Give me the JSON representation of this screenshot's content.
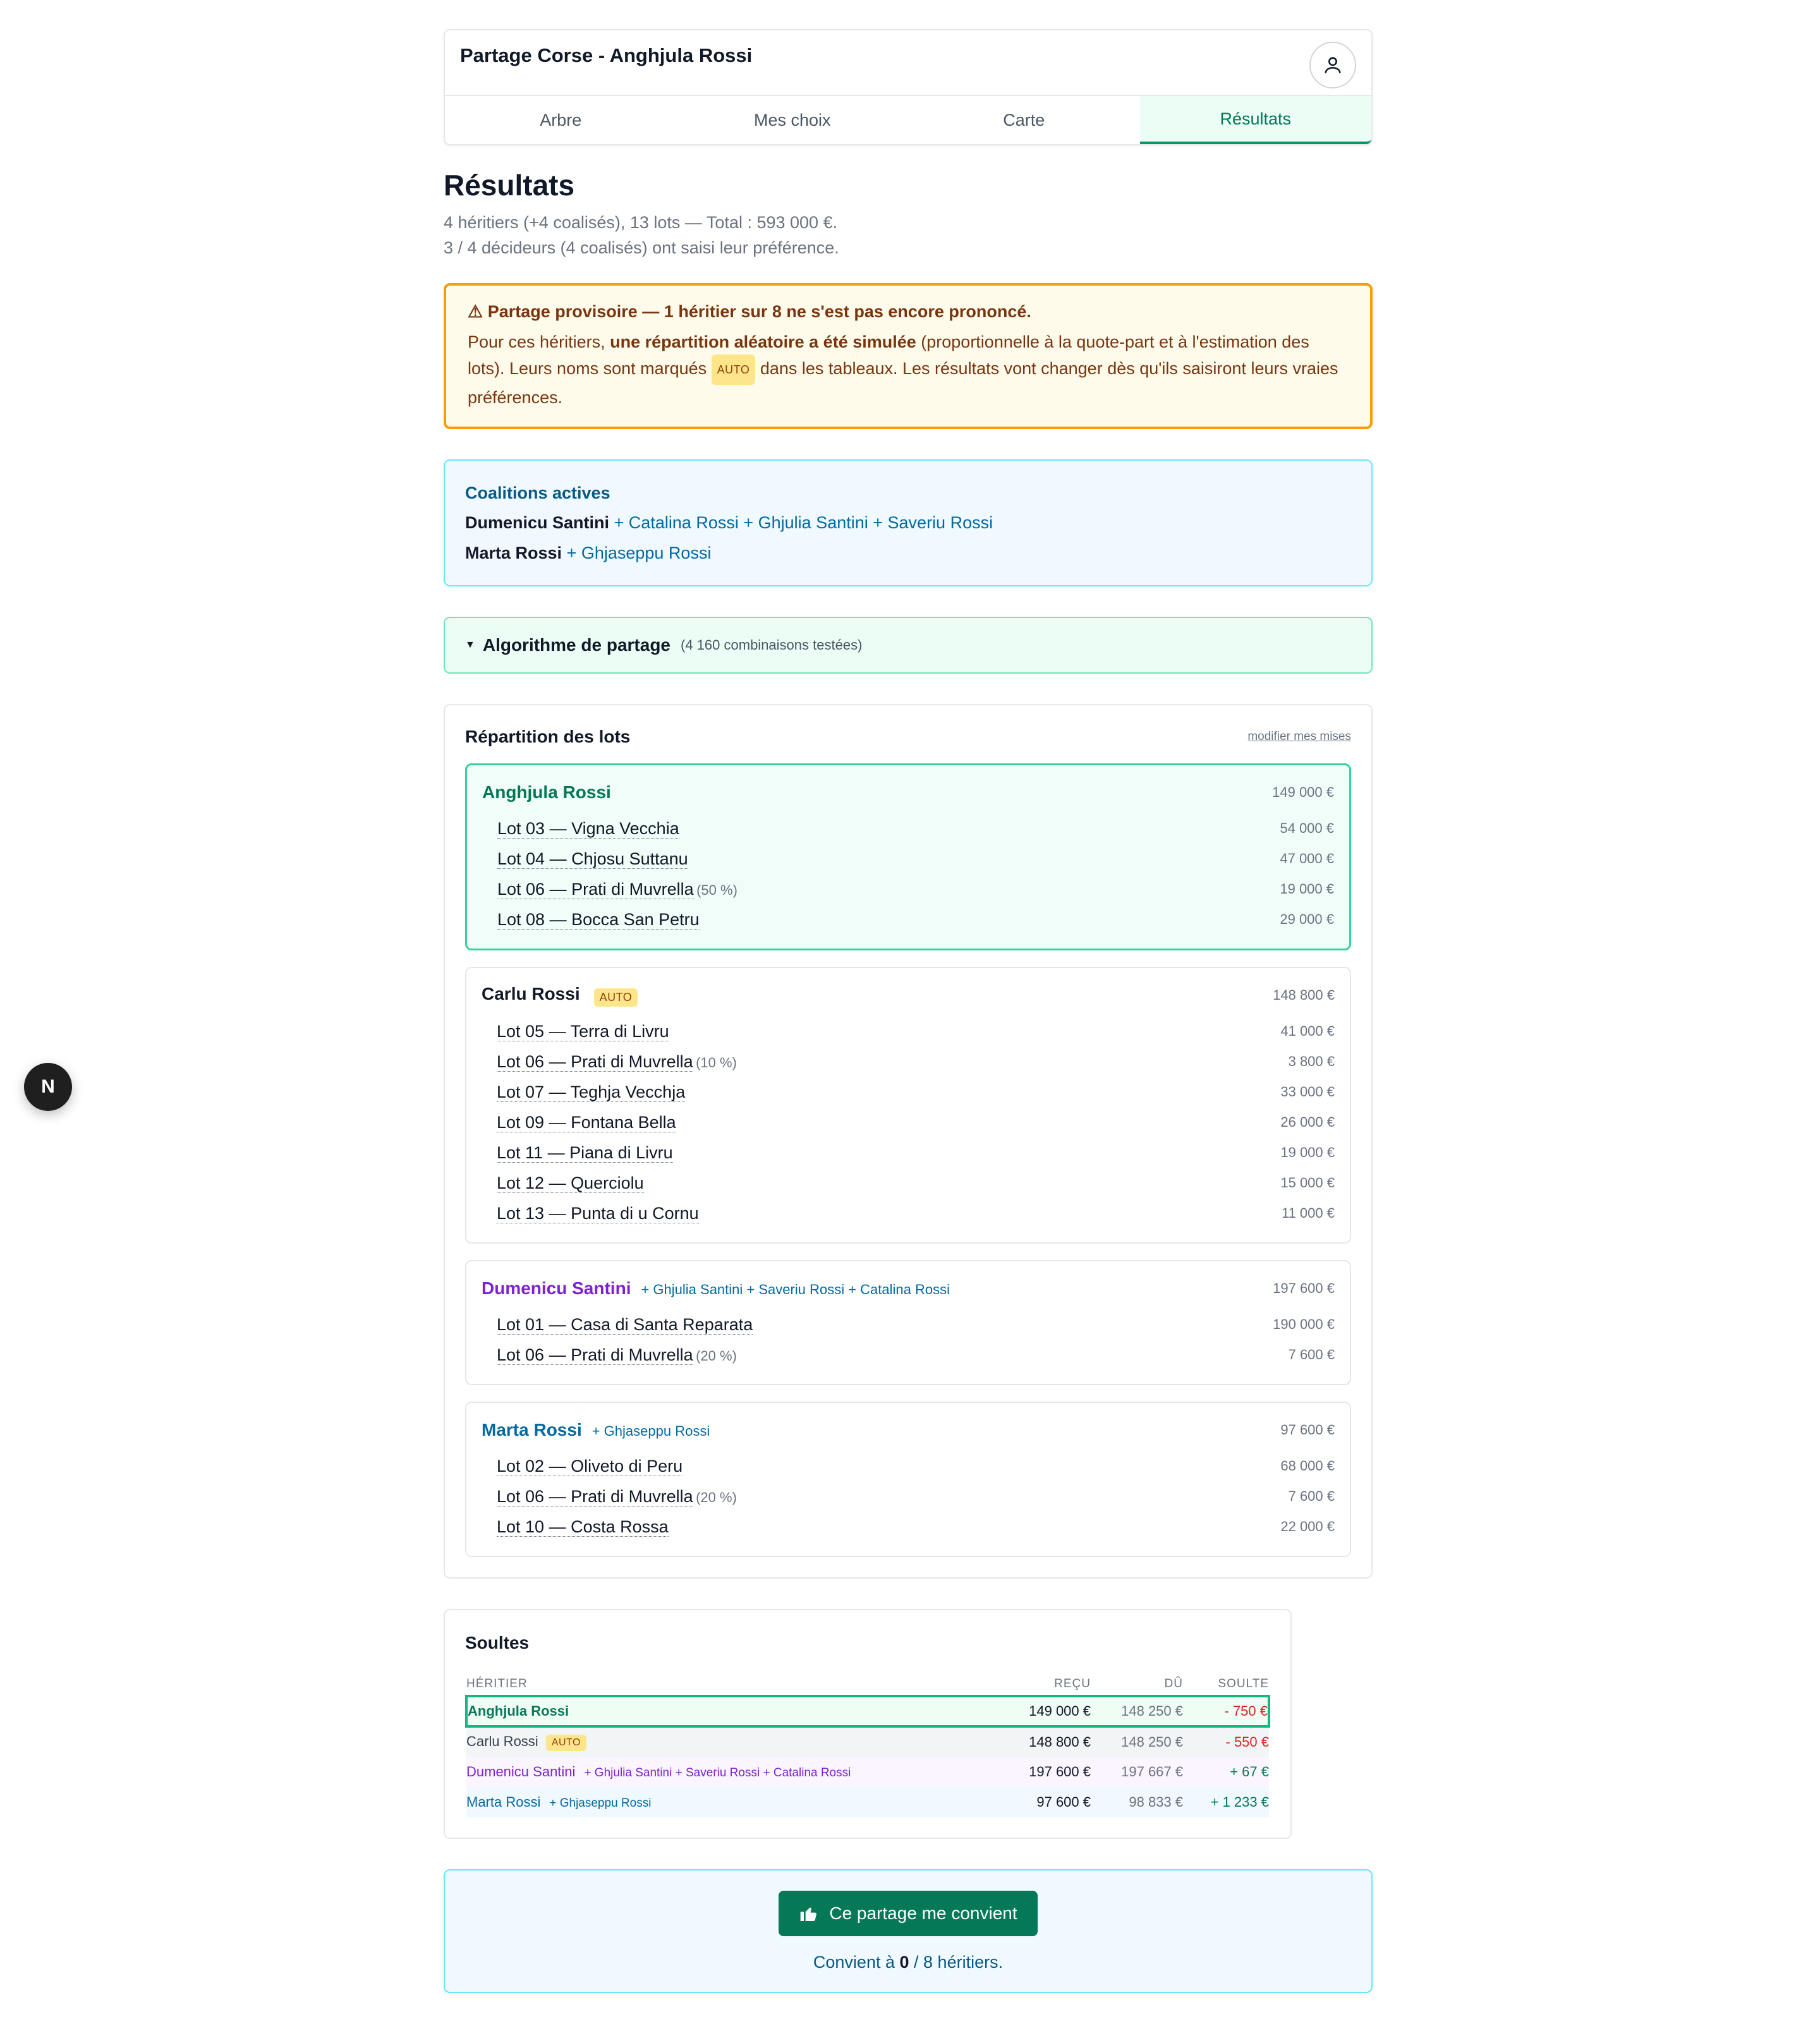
{
  "header": {
    "title": "Partage Corse - Anghjula Rossi",
    "tabs": [
      {
        "label": "Arbre"
      },
      {
        "label": "Mes choix"
      },
      {
        "label": "Carte"
      },
      {
        "label": "Résultats",
        "active": true
      }
    ]
  },
  "page": {
    "title": "Résultats",
    "summary_line1": "4 héritiers (+4 coalisés), 13 lots — Total : 593 000 €.",
    "summary_line2": "3 / 4 décideurs (4 coalisés) ont saisi leur préférence."
  },
  "warning": {
    "title": "⚠ Partage provisoire — 1 héritier sur 8 ne s'est pas encore prononcé.",
    "p1": "Pour ces héritiers, ",
    "bold": "une répartition aléatoire a été simulée",
    "p2": " (proportionnelle à la quote-part et à l'estimation des lots). Leurs noms sont marqués ",
    "badge": "AUTO",
    "p3": " dans les tableaux. Les résultats vont changer dès qu'ils saisiront leurs vraies préférences."
  },
  "coalitions": {
    "title": "Coalitions actives",
    "items": [
      {
        "leader": "Dumenicu Santini",
        "members": " + Catalina Rossi + Ghjulia Santini + Saveriu Rossi"
      },
      {
        "leader": "Marta Rossi",
        "members": " + Ghjaseppu Rossi"
      }
    ]
  },
  "algo": {
    "title": "Algorithme de partage",
    "note": "(4 160 combinaisons testées)"
  },
  "repartition": {
    "title": "Répartition des lots",
    "link": "modifier mes mises",
    "auto_badge": "AUTO",
    "heirs": [
      {
        "name": "Anghjula Rossi",
        "coal": "",
        "total": "149 000 €",
        "color": "#047857",
        "lots": [
          {
            "name": "Lot 03 — Vigna Vecchia",
            "share": "",
            "value": "54 000 €"
          },
          {
            "name": "Lot 04 — Chjosu Suttanu",
            "share": "",
            "value": "47 000 €"
          },
          {
            "name": "Lot 06 — Prati di Muvrella",
            "share": "(50 %)",
            "value": "19 000 €"
          },
          {
            "name": "Lot 08 — Bocca San Petru",
            "share": "",
            "value": "29 000 €"
          }
        ]
      },
      {
        "name": "Carlu Rossi",
        "coal": "",
        "total": "148 800 €",
        "color": "#111827",
        "lots": [
          {
            "name": "Lot 05 — Terra di Livru",
            "share": "",
            "value": "41 000 €"
          },
          {
            "name": "Lot 06 — Prati di Muvrella",
            "share": "(10 %)",
            "value": "3 800 €"
          },
          {
            "name": "Lot 07 — Teghja Vecchja",
            "share": "",
            "value": "33 000 €"
          },
          {
            "name": "Lot 09 — Fontana Bella",
            "share": "",
            "value": "26 000 €"
          },
          {
            "name": "Lot 11 — Piana di Livru",
            "share": "",
            "value": "19 000 €"
          },
          {
            "name": "Lot 12 — Querciolu",
            "share": "",
            "value": "15 000 €"
          },
          {
            "name": "Lot 13 — Punta di u Cornu",
            "share": "",
            "value": "11 000 €"
          }
        ]
      },
      {
        "name": "Dumenicu Santini",
        "coal": "+ Ghjulia Santini + Saveriu Rossi + Catalina Rossi",
        "total": "197 600 €",
        "color": "#7e22ce",
        "lots": [
          {
            "name": "Lot 01 — Casa di Santa Reparata",
            "share": "",
            "value": "190 000 €"
          },
          {
            "name": "Lot 06 — Prati di Muvrella",
            "share": "(20 %)",
            "value": "7 600 €"
          }
        ]
      },
      {
        "name": "Marta Rossi",
        "coal": "+ Ghjaseppu Rossi",
        "total": "97 600 €",
        "color": "#0369a1",
        "lots": [
          {
            "name": "Lot 02 — Oliveto di Peru",
            "share": "",
            "value": "68 000 €"
          },
          {
            "name": "Lot 06 — Prati di Muvrella",
            "share": "(20 %)",
            "value": "7 600 €"
          },
          {
            "name": "Lot 10 — Costa Rossa",
            "share": "",
            "value": "22 000 €"
          }
        ]
      }
    ]
  },
  "soultes": {
    "title": "Soultes",
    "columns": [
      "HÉRITIER",
      "REÇU",
      "DÛ",
      "SOULTE"
    ],
    "rows": [
      {
        "name": "Anghjula Rossi",
        "coal": "",
        "recu": "149 000 €",
        "du": "148 250 €",
        "soulte": "- 750 €"
      },
      {
        "name": "Carlu Rossi",
        "coal": "",
        "recu": "148 800 €",
        "du": "148 250 €",
        "soulte": "- 550 €"
      },
      {
        "name": "Dumenicu Santini",
        "coal": "+ Ghjulia Santini + Saveriu Rossi + Catalina Rossi",
        "recu": "197 600 €",
        "du": "197 667 €",
        "soulte": "+ 67 €"
      },
      {
        "name": "Marta Rossi",
        "coal": "+ Ghjaseppu Rossi",
        "recu": "97 600 €",
        "du": "98 833 €",
        "soulte": "+ 1 233 €"
      }
    ]
  },
  "accept": {
    "button": "Ce partage me convient",
    "count_prefix": "Convient à ",
    "count_value": "0",
    "count_suffix": " / 8 héritiers."
  },
  "dev_badge": "N"
}
